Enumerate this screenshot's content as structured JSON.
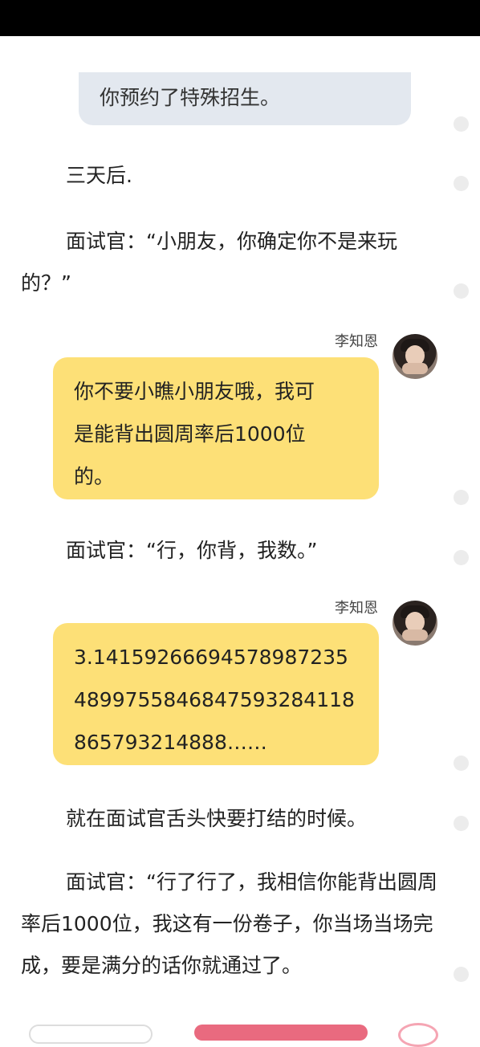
{
  "narration": "你预约了特殊招生。",
  "paragraphs": {
    "p1": "三天后.",
    "p2": "面试官：“小朋友，你确定你不是来玩的？”",
    "p3": "面试官：“行，你背，我数。”",
    "p4": "就在面试官舌头快要打结的时候。",
    "p5": "面试官：“行了行了，我相信你能背出圆周率后1000位，我这有一份卷子，你当场当场完成，要是满分的话你就通过了。"
  },
  "speaker_name": "李知恩",
  "dialogs": {
    "d1_line1": "你不要小瞧小朋友哦，我可",
    "d1_line2": "是能背出圆周率后1000位",
    "d1_line3": "的。",
    "d2_line1": "3.14159266694578987235",
    "d2_line2": "48997558468475932841​18",
    "d2_line3": "865793214888……"
  },
  "colors": {
    "dialog_bg": "#fde077",
    "narration_bg": "#e3e8ef",
    "accent_pink": "#e96a7f"
  }
}
